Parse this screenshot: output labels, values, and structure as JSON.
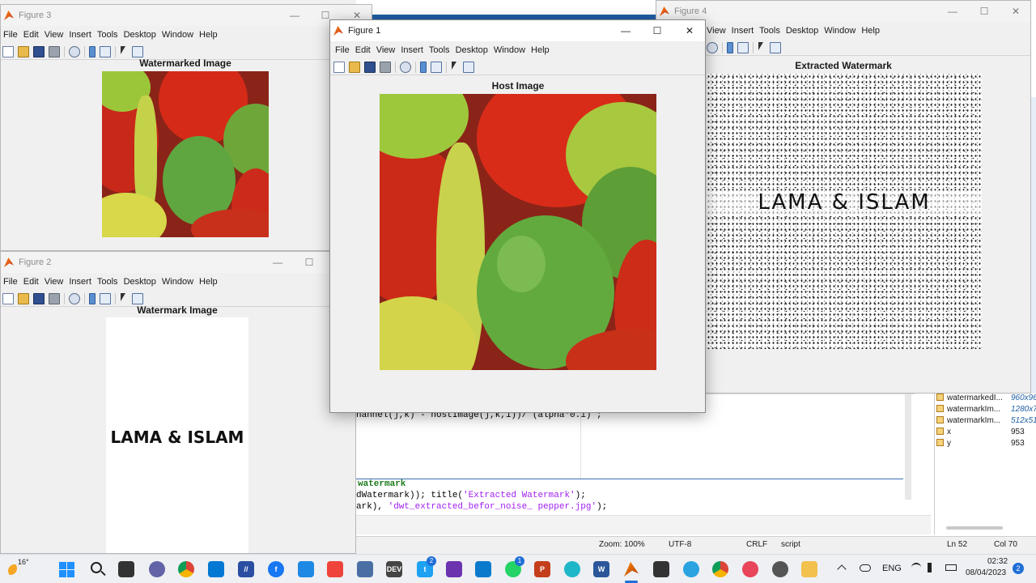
{
  "figure3": {
    "window_title": "Figure 3",
    "menu": [
      "File",
      "Edit",
      "View",
      "Insert",
      "Tools",
      "Desktop",
      "Window",
      "Help"
    ],
    "axes_title": "Watermarked Image"
  },
  "figure2": {
    "window_title": "Figure 2",
    "menu": [
      "File",
      "Edit",
      "View",
      "Insert",
      "Tools",
      "Desktop",
      "Window",
      "Help"
    ],
    "axes_title": "Watermark Image",
    "watermark_text": "LAMA & ISLAM"
  },
  "figure1": {
    "window_title": "Figure 1",
    "menu": [
      "File",
      "Edit",
      "View",
      "Insert",
      "Tools",
      "Desktop",
      "Window",
      "Help"
    ],
    "axes_title": "Host Image"
  },
  "figure4": {
    "window_title": "Figure 4",
    "menu": [
      "View",
      "Insert",
      "Tools",
      "Desktop",
      "Window",
      "Help"
    ],
    "axes_title": "Extracted Watermark",
    "watermark_text": "LAMA & ISLAM"
  },
  "editor": {
    "code_line_1": "hannel(j,k) - hostImage(j,k,1))/ (alpha*0.1) ;",
    "code_comment": "watermark",
    "code_line_2a": "dWatermark)); title(",
    "code_line_2b": "'Extracted Watermark'",
    "code_line_2c": ");",
    "code_line_3a": "ark), ",
    "code_line_3b": "'dwt_extracted_befor_noise_ pepper.jpg'",
    "code_line_3c": ");"
  },
  "workspace": {
    "rows": [
      {
        "name": "watermarkedI...",
        "value": "960x960"
      },
      {
        "name": "watermarkIm...",
        "value": "1280x7..."
      },
      {
        "name": "watermarkIm...",
        "value": "512x512"
      },
      {
        "name": "x",
        "value": "953"
      },
      {
        "name": "y",
        "value": "953"
      }
    ]
  },
  "statusbar": {
    "zoom": "Zoom: 100%",
    "encoding": "UTF-8",
    "eol": "CRLF",
    "mode": "script",
    "ln": "Ln  52",
    "col": "Col  70"
  },
  "taskbar": {
    "weather": "16°",
    "lang": "ENG",
    "time": "02:32",
    "date": "08/04/2023",
    "notif_count": "2",
    "twitter_badge": "2",
    "whatsapp_badge": "1"
  }
}
